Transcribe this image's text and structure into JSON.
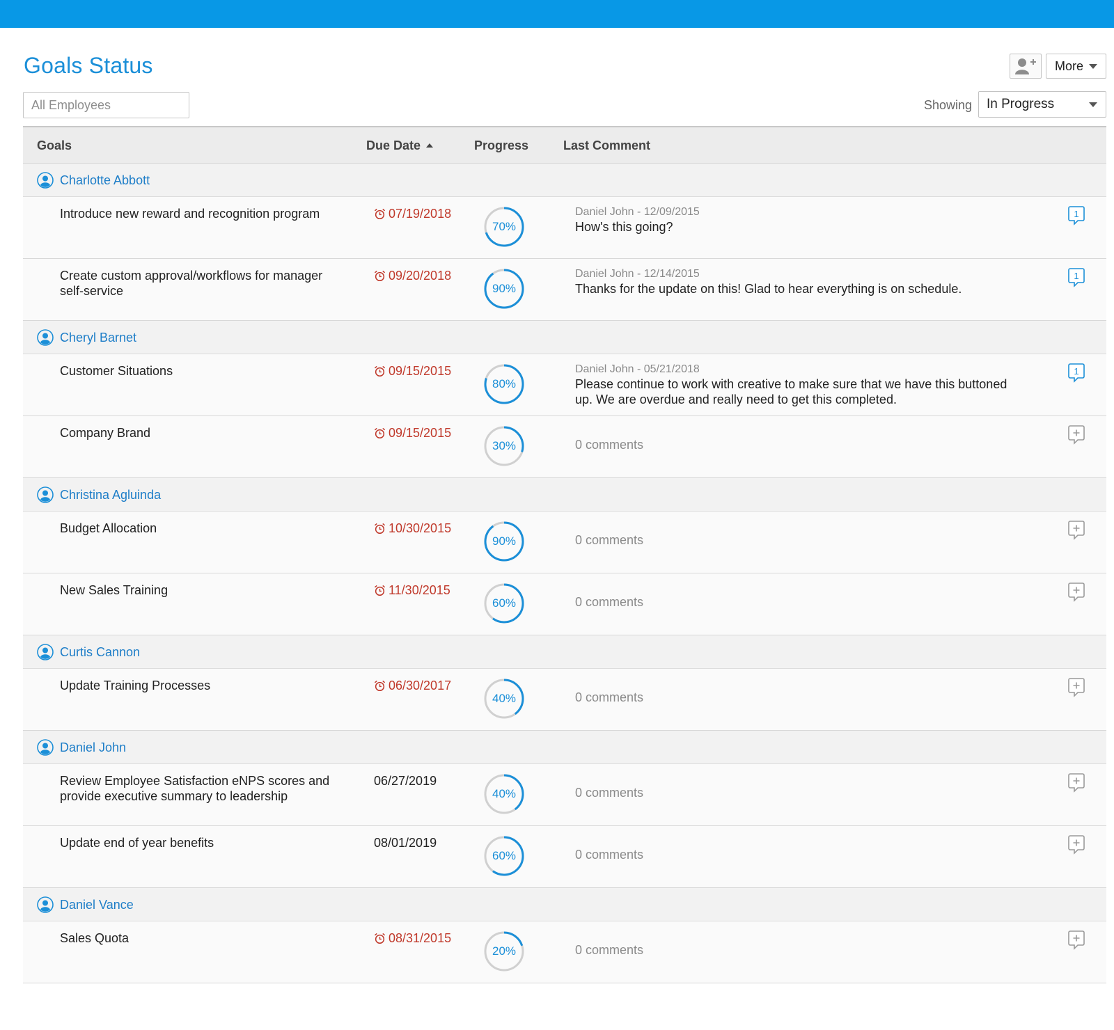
{
  "header": {
    "title": "Goals Status",
    "add_employee_icon": "add-user-icon",
    "more_label": "More"
  },
  "filters": {
    "search_placeholder": "All Employees",
    "showing_label": "Showing",
    "showing_value": "In Progress"
  },
  "table": {
    "columns": {
      "goals": "Goals",
      "due_date": "Due Date",
      "progress": "Progress",
      "last_comment": "Last Comment"
    },
    "sort": {
      "column": "due_date",
      "direction": "ascending"
    },
    "colors": {
      "accent": "#1b8fd8",
      "progress_track": "#d0d0d0",
      "overdue": "#c0392b",
      "topbar": "#0898e6"
    },
    "groups": [
      {
        "employee": "Charlotte Abbott",
        "goals": [
          {
            "title": "Introduce new reward and recognition program",
            "due": "07/19/2018",
            "overdue": true,
            "progress": 70,
            "comment_meta": "Daniel John - 12/09/2015",
            "comment_text": "How's this going?",
            "comment_count": "1"
          },
          {
            "title": "Create custom approval/workflows for manager self-service",
            "due": "09/20/2018",
            "overdue": true,
            "progress": 90,
            "comment_meta": "Daniel John - 12/14/2015",
            "comment_text": "Thanks for the update on this! Glad to hear everything is on schedule.",
            "comment_count": "1"
          }
        ]
      },
      {
        "employee": "Cheryl Barnet",
        "goals": [
          {
            "title": "Customer Situations",
            "due": "09/15/2015",
            "overdue": true,
            "progress": 80,
            "comment_meta": "Daniel John - 05/21/2018",
            "comment_text": "Please continue to work with creative to make sure that we have this buttoned up. We are overdue and really need to get this completed.",
            "comment_count": "1"
          },
          {
            "title": "Company Brand",
            "due": "09/15/2015",
            "overdue": true,
            "progress": 30,
            "no_comments": "0 comments"
          }
        ]
      },
      {
        "employee": "Christina Agluinda",
        "goals": [
          {
            "title": "Budget Allocation",
            "due": "10/30/2015",
            "overdue": true,
            "progress": 90,
            "no_comments": "0 comments"
          },
          {
            "title": "New Sales Training",
            "due": "11/30/2015",
            "overdue": true,
            "progress": 60,
            "no_comments": "0 comments"
          }
        ]
      },
      {
        "employee": "Curtis Cannon",
        "goals": [
          {
            "title": "Update Training Processes",
            "due": "06/30/2017",
            "overdue": true,
            "progress": 40,
            "no_comments": "0 comments"
          }
        ]
      },
      {
        "employee": "Daniel John",
        "goals": [
          {
            "title": "Review Employee Satisfaction eNPS scores and provide executive summary to leadership",
            "due": "06/27/2019",
            "overdue": false,
            "progress": 40,
            "no_comments": "0 comments"
          },
          {
            "title": "Update end of year benefits",
            "due": "08/01/2019",
            "overdue": false,
            "progress": 60,
            "no_comments": "0 comments"
          }
        ]
      },
      {
        "employee": "Daniel Vance",
        "goals": [
          {
            "title": "Sales Quota",
            "due": "08/31/2015",
            "overdue": true,
            "progress": 20,
            "no_comments": "0 comments"
          }
        ]
      }
    ]
  }
}
